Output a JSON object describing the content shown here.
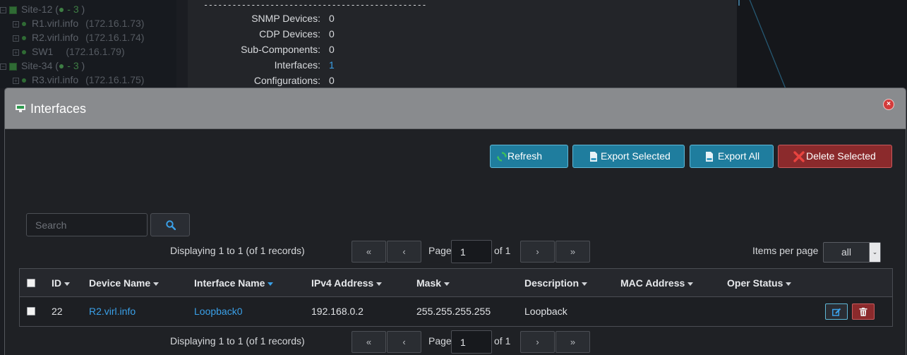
{
  "background": {
    "tree": [
      {
        "label": "Site-12 (",
        "count": "● - 3",
        "suffix": " )",
        "type": "site"
      },
      {
        "label": "R1.virl.info",
        "ip": "(172.16.1.73)",
        "type": "device"
      },
      {
        "label": "R2.virl.info",
        "ip": "(172.16.1.74)",
        "type": "device"
      },
      {
        "label": "SW1",
        "ip": "(172.16.1.79)",
        "type": "device"
      },
      {
        "label": "Site-34 (",
        "count": "● - 3",
        "suffix": " )",
        "type": "site"
      },
      {
        "label": "R3.virl.info",
        "ip": "(172.16.1.75)",
        "type": "device"
      }
    ],
    "divider": "-----------------------------------------------",
    "summary": [
      {
        "label": "SNMP Devices:",
        "value": "0"
      },
      {
        "label": "CDP Devices:",
        "value": "0"
      },
      {
        "label": "Sub-Components:",
        "value": "0"
      },
      {
        "label": "Interfaces:",
        "value": "1",
        "link": true
      },
      {
        "label": "Configurations:",
        "value": "0"
      }
    ]
  },
  "modal": {
    "title": "Interfaces",
    "close_label": "×"
  },
  "toolbar": {
    "refresh": "Refresh",
    "export_selected": "Export Selected",
    "export_all": "Export All",
    "delete_selected": "Delete Selected"
  },
  "search": {
    "placeholder": "Search",
    "value": ""
  },
  "pager": {
    "displaying": "Displaying 1 to 1 (of 1 records)",
    "first": "«",
    "prev": "‹",
    "next": "›",
    "last": "»",
    "page_label": "Page",
    "page_value": "1",
    "of_label": "of 1",
    "items_per_page_label": "Items per page",
    "items_per_page_value": "all",
    "select_arrow": "⌄"
  },
  "table": {
    "columns": [
      "ID",
      "Device Name",
      "Interface Name",
      "IPv4 Address",
      "Mask",
      "Description",
      "MAC Address",
      "Oper Status"
    ],
    "active_sort_column": "Interface Name",
    "rows": [
      {
        "id": "22",
        "device_name": "R2.virl.info",
        "interface_name": "Loopback0",
        "ipv4": "192.168.0.2",
        "mask": "255.255.255.255",
        "description": "Loopback",
        "mac": "",
        "oper_status": ""
      }
    ]
  },
  "colors": {
    "accent_blue": "#1f7d9e",
    "danger_red": "#8b2a2c",
    "link_blue": "#3aa0e8"
  }
}
